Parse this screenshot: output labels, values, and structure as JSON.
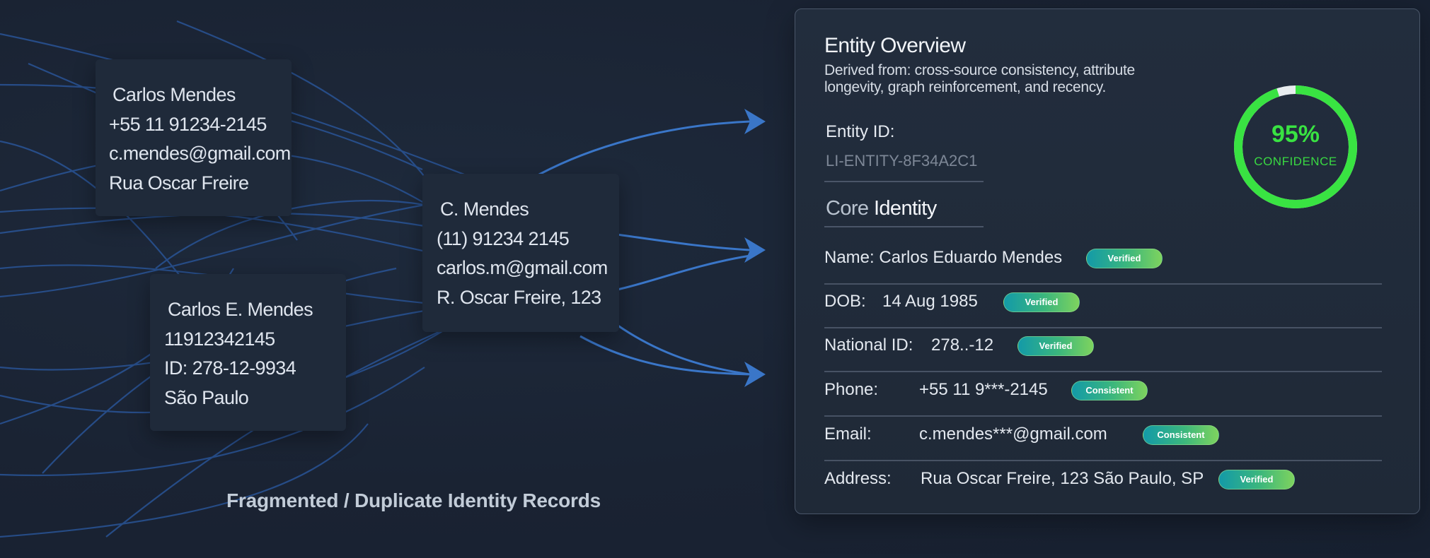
{
  "records": [
    {
      "lines": [
        "Carlos Mendes",
        "+55 11 91234-2145",
        "c.mendes@gmail.com",
        "Rua Oscar Freire"
      ]
    },
    {
      "lines": [
        "C. Mendes",
        "(11) 91234 2145",
        "carlos.m@gmail.com",
        "R. Oscar Freire, 123"
      ]
    },
    {
      "lines": [
        "Carlos E. Mendes",
        "11912342145",
        "ID: 278-12-9934",
        "São Paulo"
      ]
    }
  ],
  "caption": "Fragmented / Duplicate Identity Records",
  "panel": {
    "title": "Entity Overview",
    "subtitle": "Derived from: cross-source consistency, attribute longevity, graph reinforcement, and recency.",
    "entity_id_label": "Entity ID:",
    "entity_id_value": "LI-ENTITY-8F34A2C1",
    "core_identity_word1": "Core",
    "core_identity_word2": "Identity",
    "confidence": {
      "value": 95,
      "text": "95%",
      "label": "CONFIDENCE",
      "color": "#39e342",
      "track_color": "#e8ecef"
    },
    "rows": [
      {
        "label": "Name: Carlos Eduardo Mendes",
        "value": "",
        "badge": "Verified"
      },
      {
        "label": "DOB:",
        "value": "14 Aug 1985",
        "badge": "Verified"
      },
      {
        "label": "National ID:",
        "value": "278..-12",
        "badge": "Verified"
      },
      {
        "label": "Phone:",
        "value": "+55 11 9***-2145",
        "badge": "Consistent"
      },
      {
        "label": "Email:",
        "value": "c.mendes***@gmail.com",
        "badge": "Consistent"
      },
      {
        "label": "Address:",
        "value": "Rua Oscar Freire, 123 São Paulo, SP",
        "badge": "Verified"
      }
    ]
  },
  "colors": {
    "flow_line": "#2f63b0",
    "arrow": "#3a76c8",
    "badge_start": "#139aa8",
    "badge_end": "#7ed35e"
  }
}
